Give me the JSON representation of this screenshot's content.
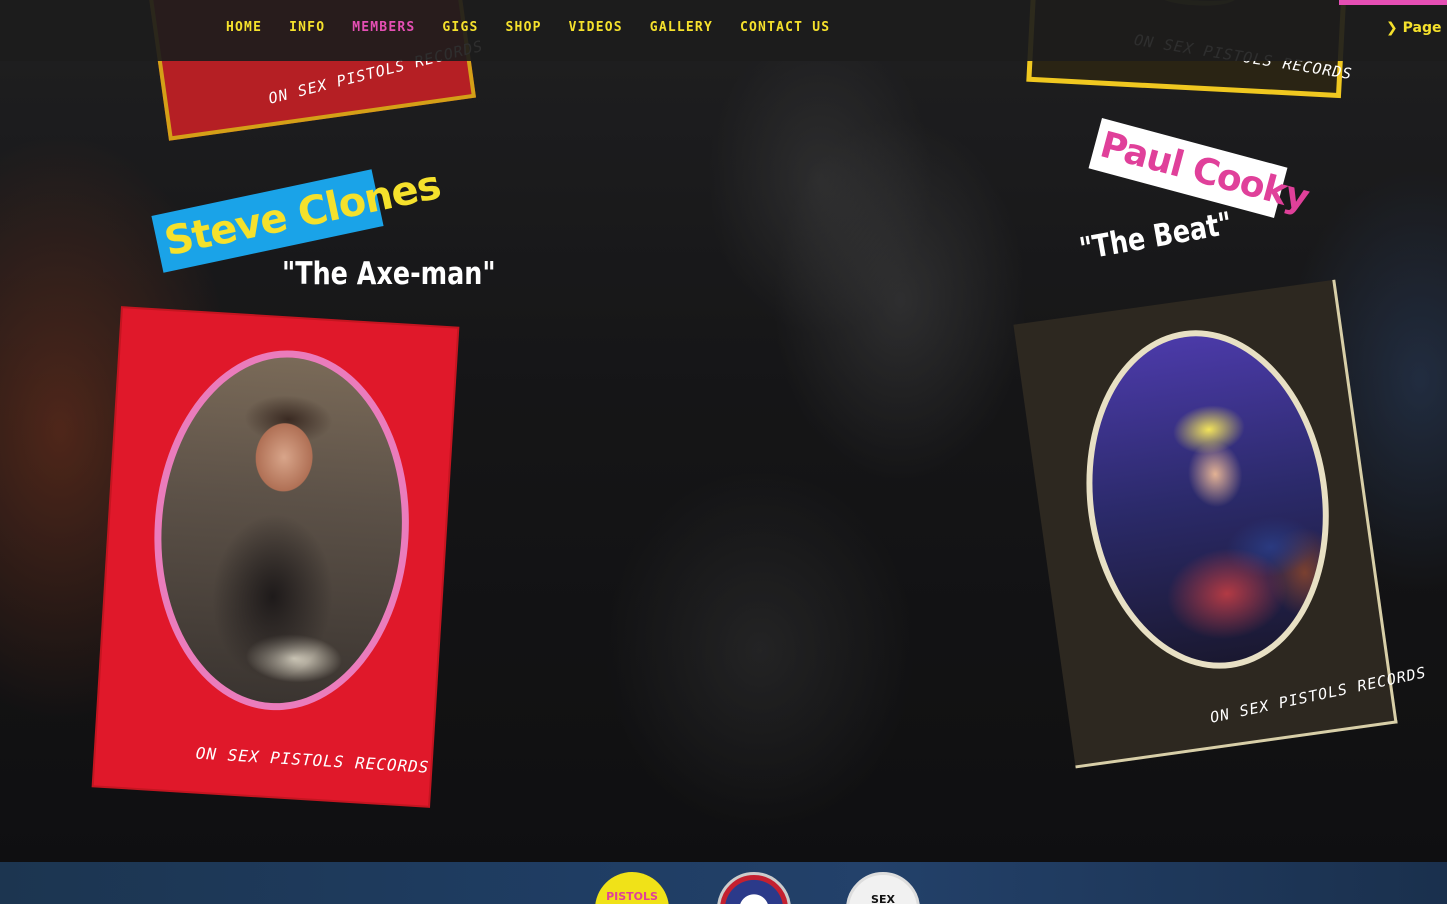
{
  "nav": {
    "items": [
      "Home",
      "Info",
      "Members",
      "Gigs",
      "Shop",
      "Videos",
      "Gallery",
      "Contact Us"
    ],
    "active": "Members",
    "page_menu": "Page Me"
  },
  "posters": {
    "top_left_label": "ON  SEX  PISTOLS  RECORDS",
    "top_right_label": "ON  SEX  PISTOLS  RECORDS",
    "steve": {
      "name": "Steve Clones",
      "nickname": "\"The Axe-man\"",
      "label": "ON  SEX  PISTOLS  RECORDS"
    },
    "paul": {
      "name": "Paul Cooky",
      "nickname": "\"The Beat\"",
      "label": "ON  SEX  PISTOLS  RECORDS"
    }
  },
  "footer": {
    "badge_yellow": "PISTOLS",
    "badge_white": "SEX"
  },
  "colors": {
    "nav_text": "#f5e12c",
    "nav_active": "#e54fb4",
    "steve_sticker": "#1aa3e8",
    "paul_sticker_text": "#e0409a"
  }
}
